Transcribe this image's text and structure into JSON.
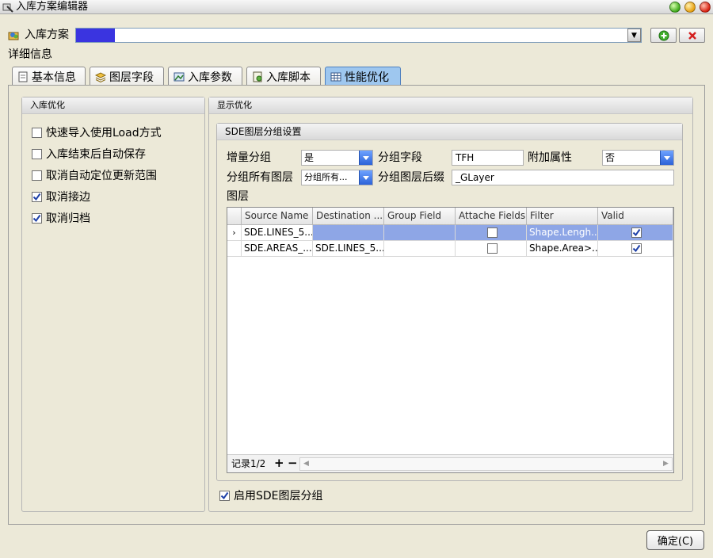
{
  "window": {
    "title": "入库方案编辑器"
  },
  "scheme": {
    "label": "入库方案",
    "value": ""
  },
  "details_label": "详细信息",
  "tabs": [
    {
      "label": "基本信息",
      "icon": "document-icon"
    },
    {
      "label": "图层字段",
      "icon": "layers-icon"
    },
    {
      "label": "入库参数",
      "icon": "image-params-icon"
    },
    {
      "label": "入库脚本",
      "icon": "script-icon"
    },
    {
      "label": "性能优化",
      "icon": "grid-icon",
      "active": true
    }
  ],
  "import_opt": {
    "title": "入库优化",
    "options": [
      {
        "label": "快速导入使用Load方式",
        "checked": false
      },
      {
        "label": "入库结束后自动保存",
        "checked": false
      },
      {
        "label": "取消自动定位更新范围",
        "checked": false
      },
      {
        "label": "取消接边",
        "checked": true
      },
      {
        "label": "取消归档",
        "checked": true
      }
    ]
  },
  "display_opt": {
    "title": "显示优化",
    "sde": {
      "title": "SDE图层分组设置",
      "incremental_label": "增量分组",
      "incremental_value": "是",
      "group_field_label": "分组字段",
      "group_field_value": "TFH",
      "extra_attr_label": "附加属性",
      "extra_attr_value": "否",
      "all_layers_label": "分组所有图层",
      "all_layers_value": "分组所有...",
      "suffix_label": "分组图层后缀",
      "suffix_value": "_GLayer",
      "layers_label": "图层",
      "columns": [
        "Source Name",
        "Destination ...",
        "Group Field",
        "Attache Fields",
        "Filter",
        "Valid"
      ],
      "rows": [
        {
          "source": "SDE.LINES_5...",
          "dest": "",
          "group": "",
          "attach": false,
          "filter": "Shape.Lengh...",
          "valid": true,
          "selected": true
        },
        {
          "source": "SDE.AREAS_...",
          "dest": "SDE.LINES_5...",
          "group": "",
          "attach": false,
          "filter": "Shape.Area>...",
          "valid": true,
          "selected": false
        }
      ],
      "record_label": "记录1/2",
      "add_symbol": "+",
      "remove_symbol": "−"
    },
    "enable_sde": {
      "label": "启用SDE图层分组",
      "checked": true
    }
  },
  "ok_button": "确定(C)",
  "colors": {
    "selection": "#8ea6e6",
    "active_tab": "#9ec7ef",
    "scheme_highlight": "#3a34e0"
  }
}
